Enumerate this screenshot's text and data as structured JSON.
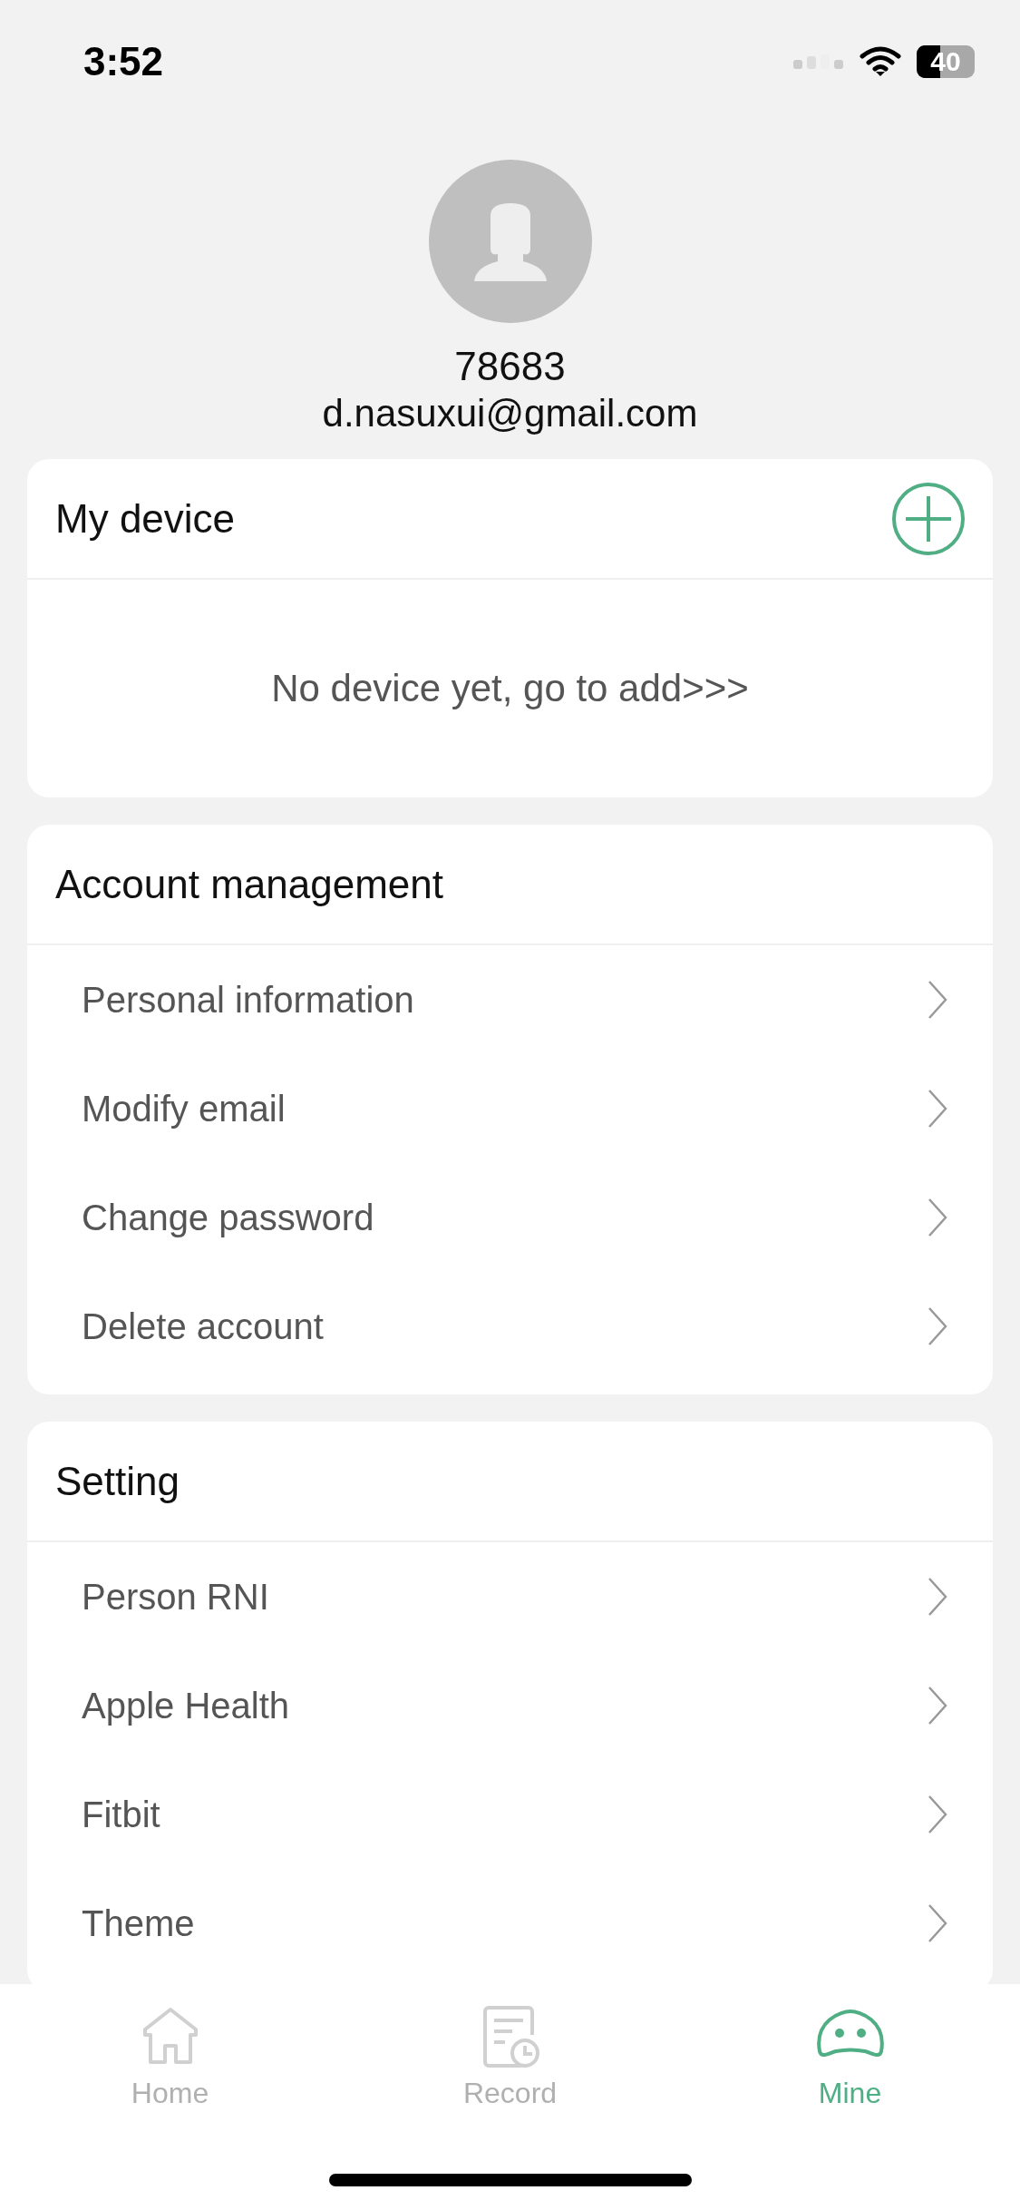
{
  "status_bar": {
    "time": "3:52",
    "battery": "40"
  },
  "profile": {
    "user_id": "78683",
    "email": "d.nasuxui@gmail.com"
  },
  "sections": [
    {
      "kind": "device",
      "title": "My device",
      "empty_text": "No device yet, go to add>>>"
    },
    {
      "kind": "menu",
      "title": "Account management",
      "items": [
        {
          "label": "Personal information"
        },
        {
          "label": "Modify email"
        },
        {
          "label": "Change password"
        },
        {
          "label": "Delete account"
        }
      ]
    },
    {
      "kind": "menu",
      "title": "Setting",
      "items": [
        {
          "label": "Person RNI"
        },
        {
          "label": "Apple Health"
        },
        {
          "label": "Fitbit"
        },
        {
          "label": "Theme"
        }
      ]
    }
  ],
  "tab_bar": [
    {
      "label": "Home",
      "kind": "home",
      "selected": false
    },
    {
      "label": "Record",
      "kind": "record",
      "selected": false
    },
    {
      "label": "Mine",
      "kind": "mine",
      "selected": true
    }
  ]
}
